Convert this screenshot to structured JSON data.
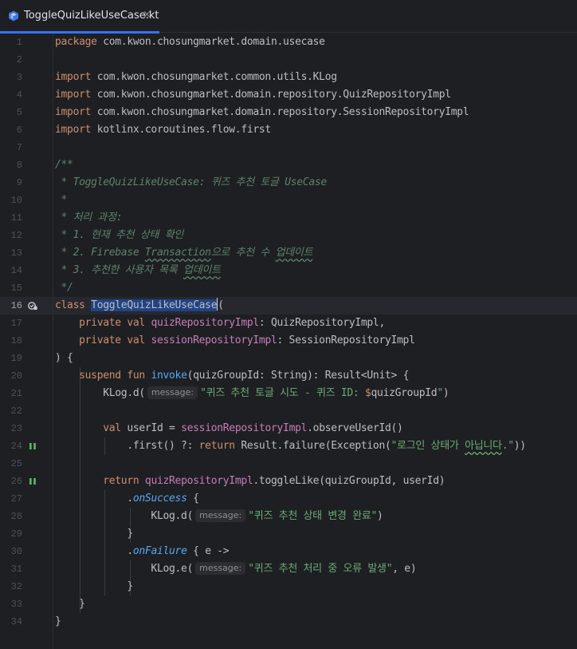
{
  "tab": {
    "title": "ToggleQuizLikeUseCase.kt",
    "close": "×"
  },
  "editor": {
    "active_line": 16,
    "lines": [
      {
        "n": "1",
        "t": [
          [
            "kw",
            "package"
          ],
          [
            "",
            "com.kwon.chosungmarket.domain.usecase"
          ]
        ]
      },
      {
        "n": "2",
        "t": []
      },
      {
        "n": "3",
        "t": [
          [
            "kw",
            "import"
          ],
          [
            "",
            "com.kwon.chosungmarket.common.utils.KLog"
          ]
        ]
      },
      {
        "n": "4",
        "t": [
          [
            "kw",
            "import"
          ],
          [
            "",
            "com.kwon.chosungmarket.domain.repository.QuizRepositoryImpl"
          ]
        ]
      },
      {
        "n": "5",
        "t": [
          [
            "kw",
            "import"
          ],
          [
            "",
            "com.kwon.chosungmarket.domain.repository.SessionRepositoryImpl"
          ]
        ]
      },
      {
        "n": "6",
        "t": [
          [
            "kw",
            "import"
          ],
          [
            "",
            "kotlinx.coroutines.flow.first"
          ]
        ]
      },
      {
        "n": "7",
        "t": []
      },
      {
        "n": "8",
        "t": [
          [
            "cmt",
            "/**"
          ]
        ]
      },
      {
        "n": "9",
        "t": [
          [
            "cmt",
            " * ToggleQuizLikeUseCase: 퀴즈 추천 토글 UseCase"
          ]
        ]
      },
      {
        "n": "10",
        "t": [
          [
            "cmt",
            " *"
          ]
        ]
      },
      {
        "n": "11",
        "t": [
          [
            "cmt",
            " * 처리 과정:"
          ]
        ]
      },
      {
        "n": "12",
        "t": [
          [
            "cmt",
            " * 1. 현재 추천 상태 확인"
          ]
        ]
      },
      {
        "n": "13",
        "t": [
          [
            "cmt",
            " * 2. Firebase "
          ],
          [
            "cmt typo",
            "Transaction"
          ],
          [
            "cmt",
            "으로 추천 수 "
          ],
          [
            "cmt typo",
            "업데이트"
          ]
        ]
      },
      {
        "n": "14",
        "t": [
          [
            "cmt",
            " * 3. 추천한 사용자 목록 "
          ],
          [
            "cmt typo",
            "업데이트"
          ]
        ]
      },
      {
        "n": "15",
        "t": [
          [
            "cmt",
            " */"
          ]
        ]
      },
      {
        "n": "16",
        "t": [
          [
            "kw",
            "class"
          ],
          [
            "",
            " "
          ],
          [
            "sel",
            "ToggleQuizLikeUseCase"
          ],
          [
            "cursor",
            ""
          ],
          [
            "",
            "("
          ]
        ]
      },
      {
        "n": "17",
        "t": [
          [
            "",
            "    "
          ],
          [
            "kw",
            "private val"
          ],
          [
            "",
            " "
          ],
          [
            "fld",
            "quizRepositoryImpl"
          ],
          [
            "",
            ": QuizRepositoryImpl,"
          ]
        ]
      },
      {
        "n": "18",
        "t": [
          [
            "",
            "    "
          ],
          [
            "kw",
            "private val"
          ],
          [
            "",
            " "
          ],
          [
            "fld",
            "sessionRepositoryImpl"
          ],
          [
            "",
            ": SessionRepositoryImpl"
          ]
        ]
      },
      {
        "n": "19",
        "t": [
          [
            "",
            ") {"
          ]
        ]
      },
      {
        "n": "20",
        "t": [
          [
            "",
            "    "
          ],
          [
            "kw",
            "suspend fun"
          ],
          [
            "",
            " "
          ],
          [
            "fn",
            "invoke"
          ],
          [
            "",
            "(quizGroupId: String): Result<Unit> {"
          ]
        ]
      },
      {
        "n": "21",
        "t": [
          [
            "",
            "        KLog.d("
          ],
          [
            "hint",
            "message:"
          ],
          [
            "str",
            "\"퀴즈 추천 토글 시도 - 퀴즈 ID: "
          ],
          [
            "kw",
            "$"
          ],
          [
            "",
            "quizGroupId"
          ],
          [
            "str",
            "\""
          ],
          [
            "",
            ")"
          ]
        ]
      },
      {
        "n": "22",
        "t": []
      },
      {
        "n": "23",
        "t": [
          [
            "",
            "        "
          ],
          [
            "kw",
            "val"
          ],
          [
            "",
            " userId = "
          ],
          [
            "fld",
            "sessionRepositoryImpl"
          ],
          [
            "",
            ".observeUserId()"
          ]
        ]
      },
      {
        "n": "24",
        "t": [
          [
            "",
            "            .first() ?: "
          ],
          [
            "kw",
            "return"
          ],
          [
            "",
            " Result.failure(Exception("
          ],
          [
            "str",
            "\"로그인 상태가 "
          ],
          [
            "str typo2",
            "아닙니다"
          ],
          [
            "str",
            ".\""
          ],
          [
            "",
            "))"
          ]
        ]
      },
      {
        "n": "25",
        "t": []
      },
      {
        "n": "26",
        "t": [
          [
            "",
            "        "
          ],
          [
            "kw",
            "return"
          ],
          [
            "",
            " "
          ],
          [
            "fld",
            "quizRepositoryImpl"
          ],
          [
            "",
            ".toggleLike(quizGroupId, userId)"
          ]
        ]
      },
      {
        "n": "27",
        "t": [
          [
            "",
            "            ."
          ],
          [
            "ext",
            "onSuccess"
          ],
          [
            "",
            " {"
          ]
        ]
      },
      {
        "n": "28",
        "t": [
          [
            "",
            "                KLog.d("
          ],
          [
            "hint",
            "message:"
          ],
          [
            "str",
            "\"퀴즈 추천 상태 변경 완료\""
          ],
          [
            "",
            ")"
          ]
        ]
      },
      {
        "n": "29",
        "t": [
          [
            "",
            "            }"
          ]
        ]
      },
      {
        "n": "30",
        "t": [
          [
            "",
            "            ."
          ],
          [
            "ext",
            "onFailure"
          ],
          [
            "",
            " { e ->"
          ]
        ]
      },
      {
        "n": "31",
        "t": [
          [
            "",
            "                KLog.e("
          ],
          [
            "hint",
            "message:"
          ],
          [
            "str",
            "\"퀴즈 추천 처리 중 오류 발생\""
          ],
          [
            "",
            ", e)"
          ]
        ]
      },
      {
        "n": "32",
        "t": [
          [
            "",
            "            }"
          ]
        ]
      },
      {
        "n": "33",
        "t": [
          [
            "",
            "    }"
          ]
        ]
      },
      {
        "n": "34",
        "t": [
          [
            "",
            "}"
          ]
        ]
      }
    ]
  },
  "gutter_icons": [
    {
      "line": "16",
      "icon": "implementations-icon"
    },
    {
      "line": "24",
      "icon": "suspend-call-icon"
    },
    {
      "line": "26",
      "icon": "suspend-call-icon"
    }
  ],
  "colors": {
    "background": "#1e1f22",
    "keyword": "#cf8e6d",
    "string": "#6aab73",
    "comment": "#5f826b",
    "field": "#c77dbb",
    "function": "#56a8f5",
    "selection": "#214283",
    "tab_accent": "#3574f0"
  }
}
